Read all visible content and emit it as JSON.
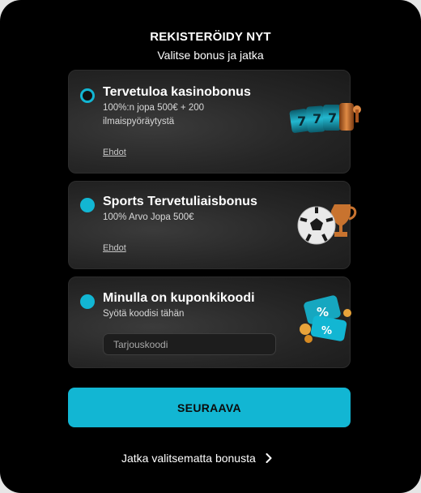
{
  "header": {
    "title": "REKISTERÖIDY NYT",
    "subtitle": "Valitse bonus ja jatka"
  },
  "bonuses": [
    {
      "title": "Tervetuloa kasinobonus",
      "description": "100%:n jopa 500€ + 200 ilmaispyöräytystä",
      "terms_label": "Ehdot",
      "selected": true,
      "icon": "slot-reels-icon"
    },
    {
      "title": "Sports Tervetuliaisbonus",
      "description": "100% Arvo Jopa 500€",
      "terms_label": "Ehdot",
      "selected": false,
      "icon": "soccer-ball-trophy-icon"
    },
    {
      "title": "Minulla on kuponkikoodi",
      "description": "Syötä koodisi tähän",
      "selected": false,
      "icon": "coupon-tickets-icon"
    }
  ],
  "coupon": {
    "placeholder": "Tarjouskoodi",
    "value": ""
  },
  "actions": {
    "next_label": "SEURAAVA",
    "skip_label": "Jatka valitsematta bonusta"
  },
  "colors": {
    "accent": "#12b6d3",
    "background": "#000000",
    "card": "#262626"
  }
}
